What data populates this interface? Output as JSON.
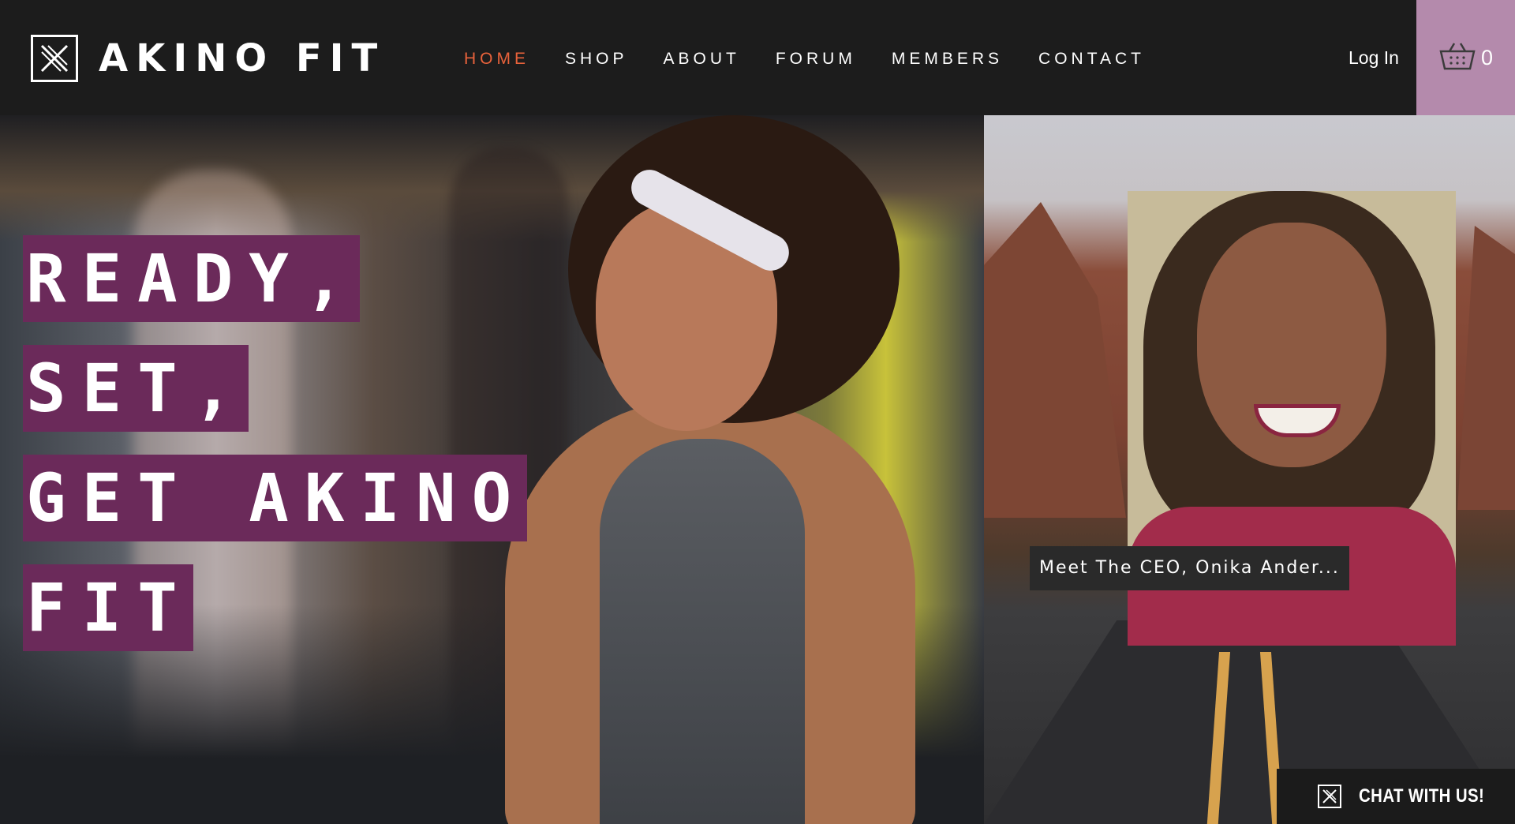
{
  "header": {
    "brand_name": "AKINO FIT",
    "nav": [
      {
        "label": "HOME",
        "active": true
      },
      {
        "label": "SHOP",
        "active": false
      },
      {
        "label": "ABOUT",
        "active": false
      },
      {
        "label": "FORUM",
        "active": false
      },
      {
        "label": "MEMBERS",
        "active": false
      },
      {
        "label": "CONTACT",
        "active": false
      }
    ],
    "login_label": "Log In",
    "cart_count": "0",
    "icons": {
      "logo": "akino-logo-icon",
      "cart": "shopping-basket-icon"
    }
  },
  "hero": {
    "headline_lines": [
      "READY,",
      "SET,",
      "GET AKINO",
      "FIT"
    ]
  },
  "video": {
    "caption": "Meet The CEO, Onika Ander..."
  },
  "chat": {
    "label": "CHAT WITH US!",
    "icon": "akino-logo-icon"
  },
  "colors": {
    "header_bg": "#1c1c1c",
    "nav_active": "#e8623b",
    "cart_bg": "#b48aac",
    "headline_bg": "#6b2a5a",
    "text": "#ffffff"
  }
}
